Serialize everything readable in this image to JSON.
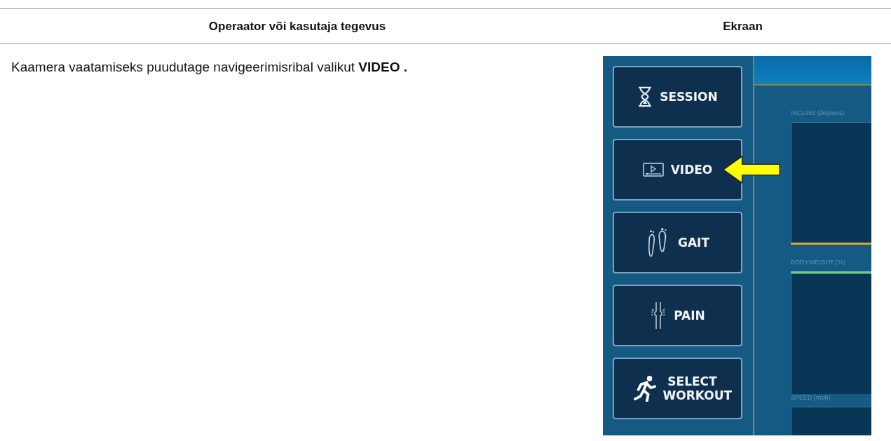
{
  "table": {
    "columns": [
      "Operaator või kasutaja tegevus",
      "Ekraan"
    ],
    "rows": [
      {
        "action": "Kaamera vaatamiseks puudutage navigeerimisribal valikut **VIDEO .**",
        "screen": {
          "nav_buttons": [
            {
              "kind": "session",
              "label": "SESSION",
              "pointed": false
            },
            {
              "kind": "video",
              "label": "VIDEO",
              "pointed": true
            },
            {
              "kind": "gait",
              "label": "GAIT",
              "pointed": false
            },
            {
              "kind": "pain",
              "label": "PAIN",
              "pointed": false
            },
            {
              "kind": "workout",
              "label": "SELECT WORKOUT",
              "pointed": false
            }
          ],
          "graphs": [
            {
              "label": "INCLINE (degrees)",
              "color": "#d9a43a"
            },
            {
              "label": "BODYWEIGHT (%)",
              "color": "#6fcf73"
            },
            {
              "label": "SPEED (mph)"
            }
          ]
        }
      }
    ]
  }
}
